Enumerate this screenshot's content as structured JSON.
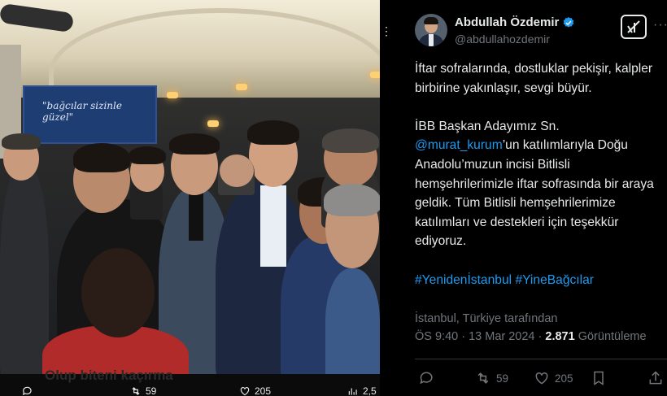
{
  "photo": {
    "banner_text": "\"bağcılar sizinle güzel\"",
    "bottom_caption": "Olup biteni kaçırma",
    "stats": {
      "retweets": "59",
      "likes": "205",
      "views": "2,5"
    }
  },
  "tweet": {
    "author_name": "Abdullah Özdemir",
    "handle": "@abdullahozdemir",
    "paragraph1": "İftar sofralarında, dostluklar pekişir, kalpler birbirine yakınlaşır, sevgi büyür.",
    "paragraph2_prefix": "İBB Başkan Adayımız Sn.",
    "mention": "@murat_kurum",
    "paragraph2_rest": "’un katılımlarıyla Doğu Anadolu’muzun incisi Bitlisli hemşehrilerimizle iftar sofrasında bir araya geldik. Tüm Bitlisli hemşehrilerimize katılımları ve destekleri için teşekkür ediyoruz.",
    "hashtag1": "#Yenidenİstanbul",
    "hashtag2": "#YineBağcılar",
    "location": "İstanbul, Türkiye tarafından",
    "time": "ÖS 9:40 · 13 Mar 2024 · ",
    "views_count": "2.871",
    "views_label": " Görüntüleme",
    "actions": {
      "retweets": "59",
      "likes": "205"
    }
  },
  "colors": {
    "accent": "#1d9bf0",
    "muted": "#71767b",
    "text": "#e7e9ea",
    "background": "#000000"
  },
  "icons": [
    "verified-icon",
    "grok-icon",
    "more-icon",
    "reply-icon",
    "retweet-icon",
    "like-icon",
    "bookmark-icon",
    "share-icon"
  ]
}
